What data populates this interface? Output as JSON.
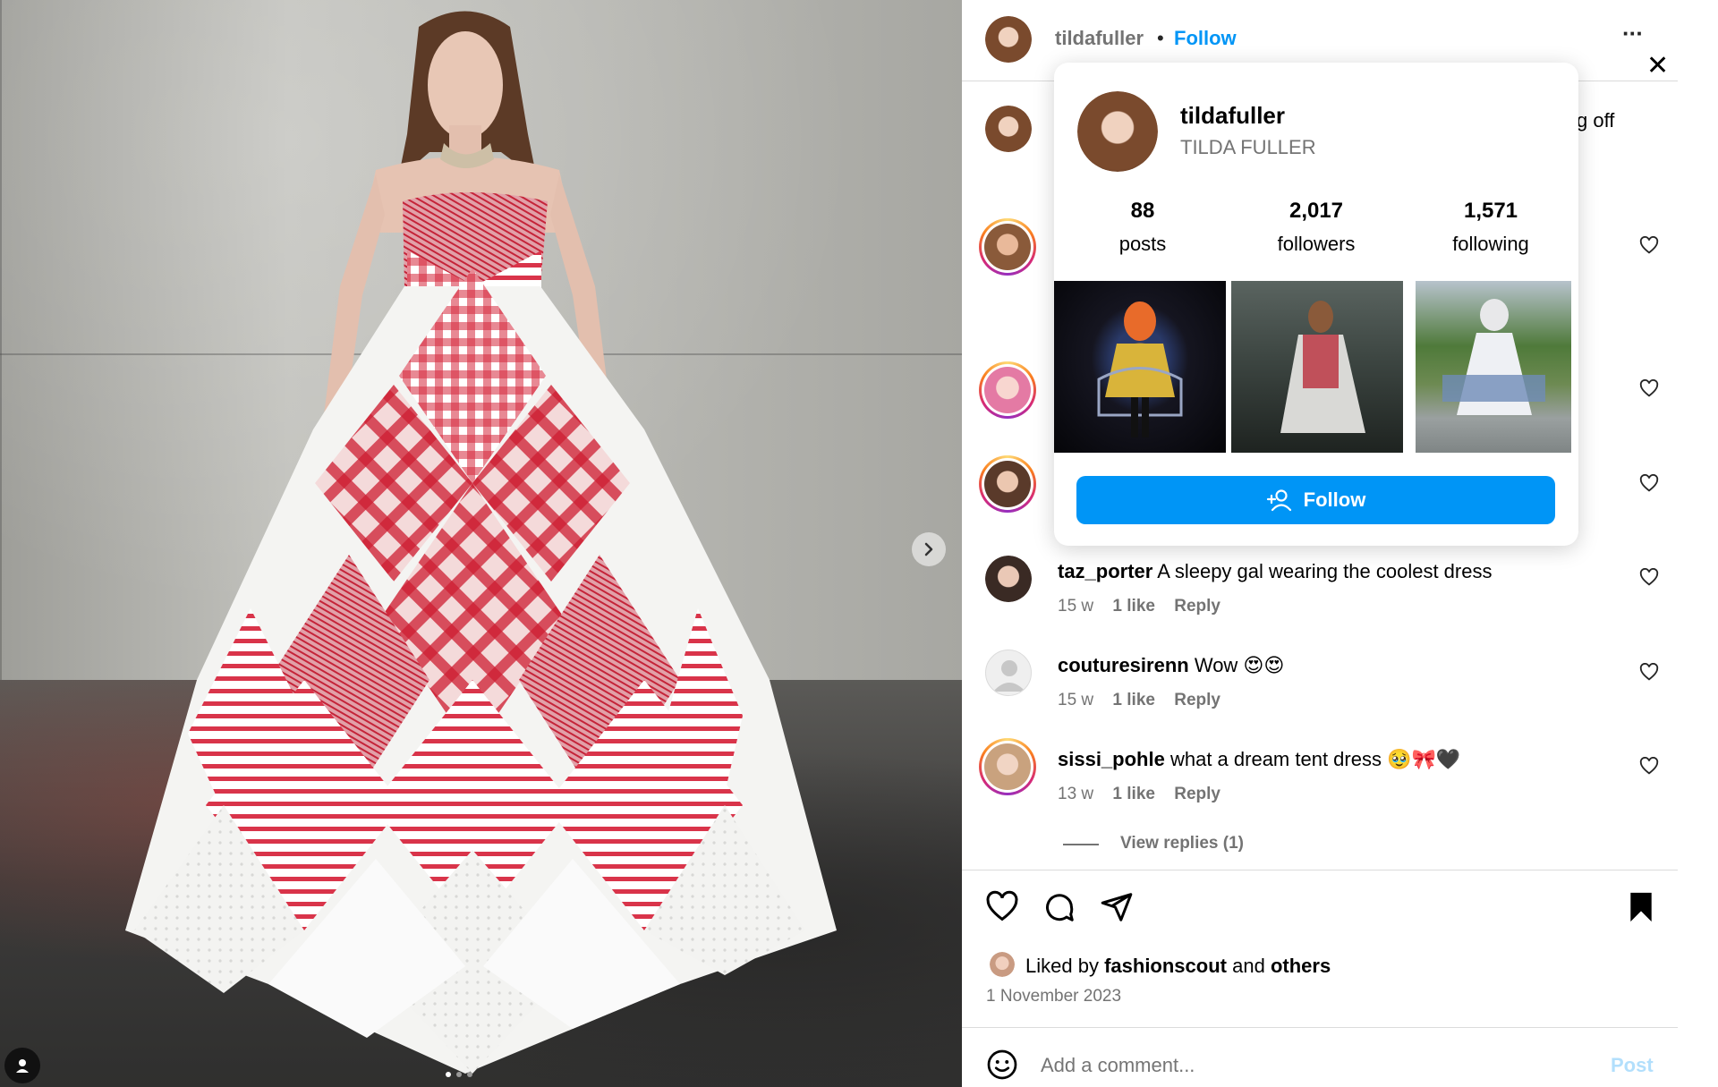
{
  "post": {
    "author": "tildafuller",
    "follow_label": "Follow",
    "separator": "•",
    "more_label": "···",
    "close_label": "✕",
    "caption_tail": "g off",
    "carousel": {
      "current": 1,
      "count": 3
    }
  },
  "hover_card": {
    "username": "tildafuller",
    "full_name": "TILDA FULLER",
    "stats": [
      {
        "value": "88",
        "label": "posts"
      },
      {
        "value": "2,017",
        "label": "followers"
      },
      {
        "value": "1,571",
        "label": "following"
      }
    ],
    "follow_label": "Follow"
  },
  "comments": [
    {
      "username": "taz_porter",
      "text": "A sleepy gal wearing the coolest dress",
      "time": "15 w",
      "likes": "1 like",
      "reply": "Reply"
    },
    {
      "username": "couturesirenn",
      "text": "Wow 😍😍",
      "time": "15 w",
      "likes": "1 like",
      "reply": "Reply"
    },
    {
      "username": "sissi_pohle",
      "text": "what a dream tent dress 🥹🎀🖤",
      "time": "13 w",
      "likes": "1 like",
      "reply": "Reply"
    }
  ],
  "view_replies": "View replies (1)",
  "likes": {
    "prefix": "Liked by",
    "user": "fashionscout",
    "conj": "and",
    "others": "others"
  },
  "date": "1 November 2023",
  "comment_box": {
    "placeholder": "Add a comment...",
    "post_label": "Post"
  },
  "colors": {
    "accent": "#0095f6",
    "muted": "#737373",
    "divider": "#dbdbdb"
  }
}
